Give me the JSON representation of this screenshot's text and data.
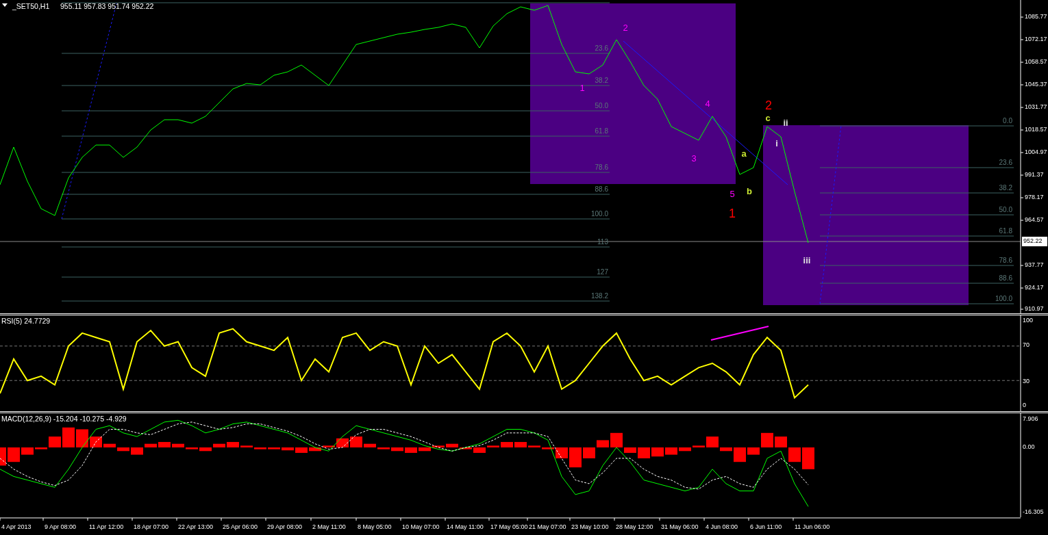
{
  "price_panel": {
    "symbol": "_SET50,H1",
    "ohlc": "955.11 957.83 951.74 952.22",
    "current_price": "952.22",
    "axis_labels": [
      "1085.77",
      "1072.17",
      "1058.57",
      "1045.37",
      "1031.77",
      "1018.57",
      "1004.97",
      "991.37",
      "978.17",
      "964.57",
      "937.77",
      "924.17",
      "910.97"
    ],
    "wave_labels": [
      {
        "text": "1",
        "color": "#ff00ff",
        "kind": "primary"
      },
      {
        "text": "2",
        "color": "#ff00ff",
        "kind": "primary"
      },
      {
        "text": "3",
        "color": "#ff00ff",
        "kind": "primary"
      },
      {
        "text": "4",
        "color": "#ff00ff",
        "kind": "primary"
      },
      {
        "text": "5",
        "color": "#ff00ff",
        "kind": "primary"
      },
      {
        "text": "1",
        "color": "#ff0000",
        "kind": "major"
      },
      {
        "text": "2",
        "color": "#ff0000",
        "kind": "major"
      },
      {
        "text": "a",
        "color": "#c8e632",
        "kind": "minor"
      },
      {
        "text": "b",
        "color": "#c8e632",
        "kind": "minor"
      },
      {
        "text": "c",
        "color": "#c8e632",
        "kind": "minor"
      },
      {
        "text": "i",
        "color": "#e0e0e0",
        "kind": "minor"
      },
      {
        "text": "ii",
        "color": "#e0e0e0",
        "kind": "minor"
      },
      {
        "text": "iii",
        "color": "#e0e0e0",
        "kind": "minor"
      }
    ],
    "fib_grids": [
      {
        "labels": [
          "23.6",
          "38.2",
          "50.0",
          "61.8",
          "78.6",
          "88.6",
          "100.0",
          "113",
          "127",
          "138.2"
        ]
      },
      {
        "labels": [
          "0.0",
          "23.6",
          "38.2",
          "50.0",
          "61.8",
          "78.6",
          "88.6",
          "100.0"
        ]
      }
    ]
  },
  "rsi_panel": {
    "label": "RSI(5) 24.7729",
    "axis_labels": [
      "100",
      "70",
      "30",
      "0"
    ]
  },
  "macd_panel": {
    "label": "MACD(12,26,9) -15.204 -10.275 -4.929",
    "axis_labels": [
      "7.906",
      "0.00",
      "-16.305"
    ]
  },
  "time_axis": {
    "labels": [
      "4 Apr 2013",
      "9 Apr 08:00",
      "11 Apr 12:00",
      "18 Apr 07:00",
      "22 Apr 13:00",
      "25 Apr 06:00",
      "29 Apr 08:00",
      "2 May 11:00",
      "8 May 05:00",
      "10 May 07:00",
      "14 May 11:00",
      "17 May 05:00",
      "21 May 07:00",
      "23 May 10:00",
      "28 May 12:00",
      "31 May 06:00",
      "4 Jun 08:00",
      "6 Jun 11:00",
      "11 Jun 06:00"
    ]
  }
}
